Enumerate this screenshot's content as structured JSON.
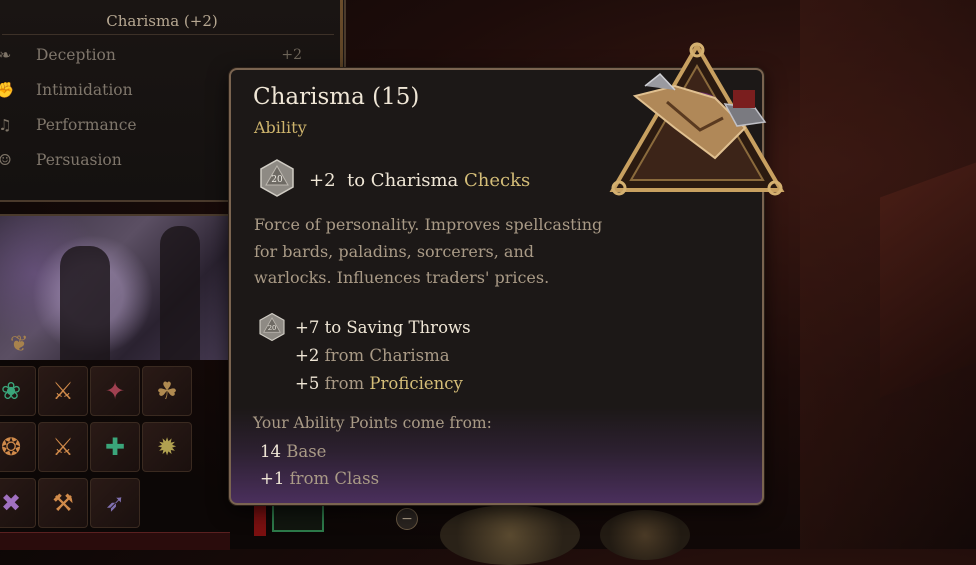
{
  "skills_panel": {
    "header": "Charisma (+2)",
    "skills": [
      {
        "label": "Deception",
        "bonus": "+2",
        "icon": "mask-icon"
      },
      {
        "label": "Intimidation",
        "bonus": "",
        "icon": "fist-icon"
      },
      {
        "label": "Performance",
        "bonus": "",
        "icon": "lute-icon"
      },
      {
        "label": "Persuasion",
        "bonus": "",
        "icon": "theatre-masks-icon"
      }
    ]
  },
  "tooltip": {
    "title": "Charisma (15)",
    "subtitle": "Ability",
    "check_bonus": "+2",
    "check_text_pre": "to Charisma",
    "check_text_highlight": "Checks",
    "description": "Force of personality. Improves spellcasting for bards, paladins, sorcerers, and warlocks. Influences traders' prices.",
    "saving_throws": {
      "total": "+7 to Saving Throws",
      "sources": [
        {
          "value": "+2",
          "text": "from",
          "source": "Charisma",
          "highlight": false
        },
        {
          "value": "+5",
          "text": "from",
          "source": "Proficiency",
          "highlight": true
        }
      ]
    },
    "ability_points_heading": "Your Ability Points come from:",
    "ability_points": [
      {
        "value": "14",
        "text": "Base"
      },
      {
        "value": "+1",
        "text": "from Class"
      }
    ],
    "die_label": "20",
    "emblem_icon": "clasped-hands-emblem-icon"
  },
  "colors": {
    "accent_gold": "#d4bd78",
    "text_primary": "#efe6d6",
    "text_secondary": "#a99a86",
    "tooltip_bg": "#1c1817",
    "tooltip_glow": "#4a2f5c"
  }
}
